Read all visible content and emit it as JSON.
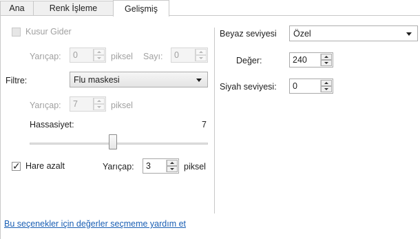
{
  "tabs": [
    {
      "label": "Ana",
      "active": false
    },
    {
      "label": "Renk İşleme",
      "active": false
    },
    {
      "label": "Gelişmiş",
      "active": true
    }
  ],
  "left": {
    "defect_removal": {
      "label": "Kusur Gider",
      "checked": false,
      "enabled": false,
      "radius_label": "Yarıçap:",
      "radius_value": "0",
      "radius_unit": "piksel",
      "count_label": "Sayı:",
      "count_value": "0"
    },
    "filter": {
      "label": "Filtre:",
      "selected": "Flu maskesi",
      "radius_label": "Yarıçap:",
      "radius_value": "7",
      "radius_unit": "piksel",
      "sensitivity_label": "Hassasiyet:",
      "sensitivity_value": "7",
      "sensitivity_level_fraction": 0.5
    },
    "moire": {
      "label": "Hare azalt",
      "checked": true,
      "radius_label": "Yarıçap:",
      "radius_value": "3",
      "radius_unit": "piksel"
    },
    "help_link": "Bu seçenekler için değerler seçmeme yardım et"
  },
  "right": {
    "white_level": {
      "label": "Beyaz seviyesi",
      "selected": "Özel"
    },
    "value": {
      "label": "Değer:",
      "value": "240"
    },
    "black_level": {
      "label": "Siyah seviyesi:",
      "value": "0"
    }
  },
  "colors": {
    "border": "#c8c8c8",
    "link": "#1a5fb4",
    "disabled_text": "#a0a0a0"
  }
}
